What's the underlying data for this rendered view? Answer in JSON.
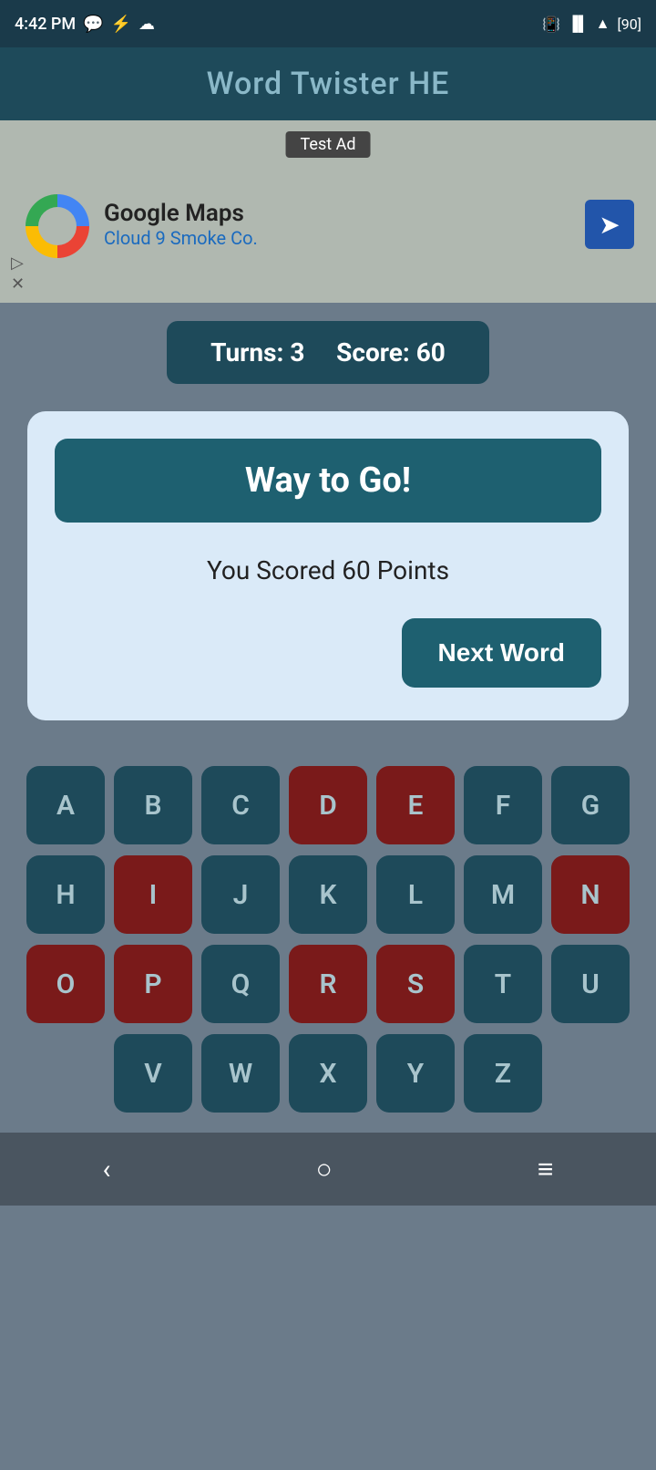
{
  "statusBar": {
    "time": "4:42 PM",
    "battery": "90"
  },
  "header": {
    "title": "Word Twister HE"
  },
  "ad": {
    "label": "Test Ad",
    "brand": "Google Maps",
    "subtitle": "Cloud 9 Smoke Co."
  },
  "scoreBar": {
    "turnsLabel": "Turns:",
    "turnsValue": "3",
    "scoreLabel": "Score:",
    "scoreValue": "60"
  },
  "dialog": {
    "headerText": "Way to Go!",
    "scoreText": "You Scored 60 Points",
    "nextWordLabel": "Next Word"
  },
  "keyboard": {
    "rows": [
      [
        "A",
        "B",
        "C",
        "D",
        "E",
        "F",
        "G"
      ],
      [
        "H",
        "I",
        "J",
        "K",
        "L",
        "M",
        "N"
      ],
      [
        "O",
        "P",
        "Q",
        "R",
        "S",
        "T",
        "U"
      ],
      [
        "V",
        "W",
        "X",
        "Y",
        "Z"
      ]
    ],
    "usedLetters": [
      "D",
      "E",
      "I",
      "N",
      "O",
      "P",
      "R",
      "S"
    ]
  },
  "navBar": {
    "backLabel": "‹",
    "homeLabel": "○",
    "menuLabel": "≡"
  }
}
